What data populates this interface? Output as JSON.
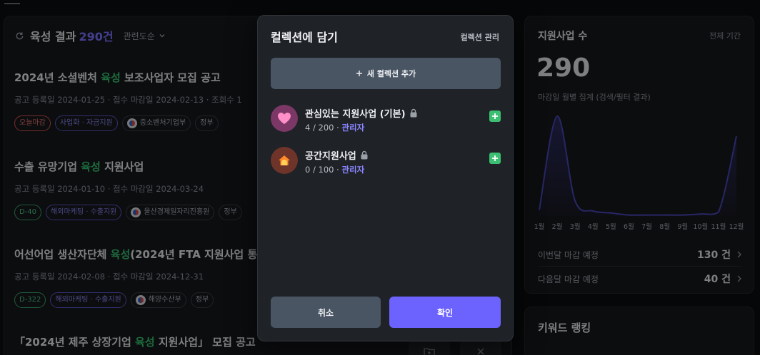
{
  "results": {
    "title": "육성 결과",
    "count": "290건",
    "sort": "관련도순"
  },
  "items": [
    {
      "title_pre": "2024년 소셜벤처 ",
      "title_hl": "육성",
      "title_post": " 보조사업자 모집 공고",
      "meta": "공고 등록일 2024-01-25 · 접수 마감일 2024-02-13 · 조회수 1",
      "tags": [
        "오늘마감",
        "사업화 · 자금지원",
        "중소벤처기업부",
        "정부"
      ]
    },
    {
      "title_pre": "수출 유망기업 ",
      "title_hl": "육성",
      "title_post": " 지원사업",
      "meta": "공고 등록일 2024-01-10 · 접수 마감일 2024-03-24",
      "tags": [
        "D-40",
        "해외마케팅 · 수출지원",
        "울산경제일자리진흥원",
        "정부"
      ]
    },
    {
      "title_pre": "어선어업 생산자단체 ",
      "title_hl": "육성",
      "title_post": "(2024년 FTA 지원사업 통",
      "meta": "공고 등록일 2024-02-08 · 접수 마감일 2024-12-31",
      "tags": [
        "D-322",
        "해외마케팅 · 수출지원",
        "해양수산부",
        "정부"
      ]
    },
    {
      "title_pre": "「2024년 제주 상장기업 ",
      "title_hl": "육성",
      "title_post": " 지원사업」 모집 공고"
    }
  ],
  "stats": {
    "title": "지원사업 수",
    "period": "전체 기간",
    "total": "290",
    "subtitle": "마감일 월별 집계 (검색/필터 결과)",
    "this_month_label": "이번달 마감 예정",
    "this_month_value": "130 건",
    "next_month_label": "다음달 마감 예정",
    "next_month_value": "40 건"
  },
  "chart_data": {
    "type": "area",
    "categories": [
      "1월",
      "2월",
      "3월",
      "4월",
      "5월",
      "6월",
      "7월",
      "8월",
      "9월",
      "10월",
      "11월",
      "12월"
    ],
    "series": [
      {
        "values": [
          6,
          100,
          15,
          5,
          3,
          1,
          1,
          1,
          1,
          2,
          4,
          80
        ]
      }
    ],
    "color": "#3a3790"
  },
  "keyword": {
    "title": "키워드 랭킹"
  },
  "modal": {
    "title": "컬렉션에 담기",
    "manage": "컬렉션 관리",
    "add_label": "새 컬렉션 추가",
    "collections": [
      {
        "name": "관심있는 지원사업 (기본)",
        "count": "4 / 200",
        "role": "관리자",
        "icon": "heart-icon",
        "color": "#8a3c6f"
      },
      {
        "name": "공간지원사업",
        "count": "0 / 100",
        "role": "관리자",
        "icon": "house-icon",
        "color": "#7a3a30"
      }
    ],
    "cancel": "취소",
    "confirm": "확인"
  }
}
